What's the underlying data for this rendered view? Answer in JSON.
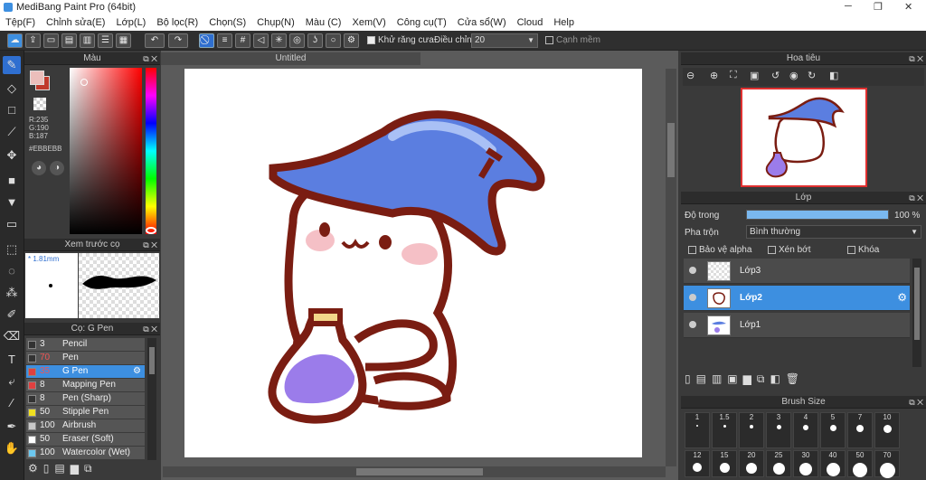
{
  "app": {
    "title": "MediBang Paint Pro (64bit)"
  },
  "menu": [
    "Tệp(F)",
    "Chỉnh sửa(E)",
    "Lớp(L)",
    "Bộ lọc(R)",
    "Chọn(S)",
    "Chụp(N)",
    "Màu (C)",
    "Xem(V)",
    "Công cụ(T)",
    "Cửa sổ(W)",
    "Cloud",
    "Help"
  ],
  "toolbar": {
    "antialias_label": "Khử răng cưa",
    "correction_label": "Điều chỉnh",
    "correction_value": "20",
    "edge_label": "Cạnh mềm"
  },
  "color_panel": {
    "title": "Màu",
    "r": "R:235",
    "g": "G:190",
    "b": "B:187",
    "hex": "#EBBEBB"
  },
  "preview_panel": {
    "title": "Xem trước cọ",
    "size": "1.81mm"
  },
  "brush_panel": {
    "title": "Cọ: G Pen",
    "items": [
      {
        "size": "3",
        "name": "Pencil",
        "color": "#333333"
      },
      {
        "size": "70",
        "name": "Pen",
        "color": "#333333"
      },
      {
        "size": "35",
        "name": "G Pen",
        "color": "#e04040"
      },
      {
        "size": "8",
        "name": "Mapping Pen",
        "color": "#e04040"
      },
      {
        "size": "8",
        "name": "Pen (Sharp)",
        "color": "#333333"
      },
      {
        "size": "50",
        "name": "Stipple Pen",
        "color": "#f0e020"
      },
      {
        "size": "100",
        "name": "Airbrush",
        "color": "#c8c8c8"
      },
      {
        "size": "50",
        "name": "Eraser (Soft)",
        "color": "#ffffff"
      },
      {
        "size": "100",
        "name": "Watercolor (Wet)",
        "color": "#6cc8f0"
      }
    ]
  },
  "canvas": {
    "tab_title": "Untitled"
  },
  "navigator": {
    "title": "Hoa tiêu"
  },
  "layer_panel": {
    "title": "Lớp",
    "opacity_label": "Độ trong",
    "opacity_value": "100 %",
    "opacity_percent": 100,
    "blend_label": "Pha trộn",
    "blend_value": "Bình thường",
    "protect_alpha": "Bảo vệ alpha",
    "clip": "Xén bớt",
    "lock": "Khóa",
    "layers": [
      {
        "name": "Lớp3"
      },
      {
        "name": "Lớp2"
      },
      {
        "name": "Lớp1"
      }
    ]
  },
  "brush_size_panel": {
    "title": "Brush Size",
    "row1": [
      "1",
      "1.5",
      "2",
      "3",
      "4",
      "5",
      "7",
      "10"
    ],
    "row2": [
      "12",
      "15",
      "20",
      "25",
      "30",
      "40",
      "50",
      "70"
    ]
  }
}
